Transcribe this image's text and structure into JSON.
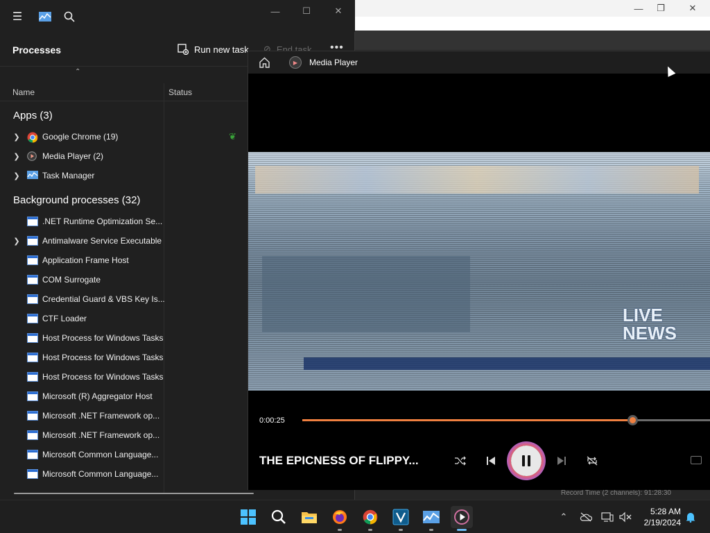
{
  "task_manager": {
    "header_title": "Processes",
    "run_new_task": "Run new task",
    "end_task": "End task",
    "more": "•••",
    "columns": {
      "name": "Name",
      "status": "Status"
    },
    "apps_group": "Apps (3)",
    "apps": [
      {
        "label": "Google Chrome (19)",
        "icon": "chrome-icon"
      },
      {
        "label": "Media Player (2)",
        "icon": "media-player-icon"
      },
      {
        "label": "Task Manager",
        "icon": "task-manager-icon"
      }
    ],
    "bg_group": "Background processes (32)",
    "background": [
      ".NET Runtime Optimization Se...",
      "Antimalware Service Executable",
      "Application Frame Host",
      "COM Surrogate",
      "Credential Guard & VBS Key Is...",
      "CTF Loader",
      "Host Process for Windows Tasks",
      "Host Process for Windows Tasks",
      "Host Process for Windows Tasks",
      "Microsoft (R) Aggregator Host",
      "Microsoft .NET Framework op...",
      "Microsoft .NET Framework op...",
      "Microsoft Common Language...",
      "Microsoft Common Language..."
    ]
  },
  "media_player": {
    "app_name": "Media Player",
    "elapsed": "0:00:25",
    "progress_fraction": 0.81,
    "song_title": "THE EPICNESS OF FLIPPY...",
    "video_overlay_text": "LIVE NEWS"
  },
  "background_window": {
    "status_line": "Record Time (2 channels): 91:28:30"
  },
  "taskbar": {
    "time": "5:28 AM",
    "date": "2/19/2024"
  },
  "colors": {
    "accent": "#f08040",
    "taskbar_indicator": "#6cb8f0"
  }
}
